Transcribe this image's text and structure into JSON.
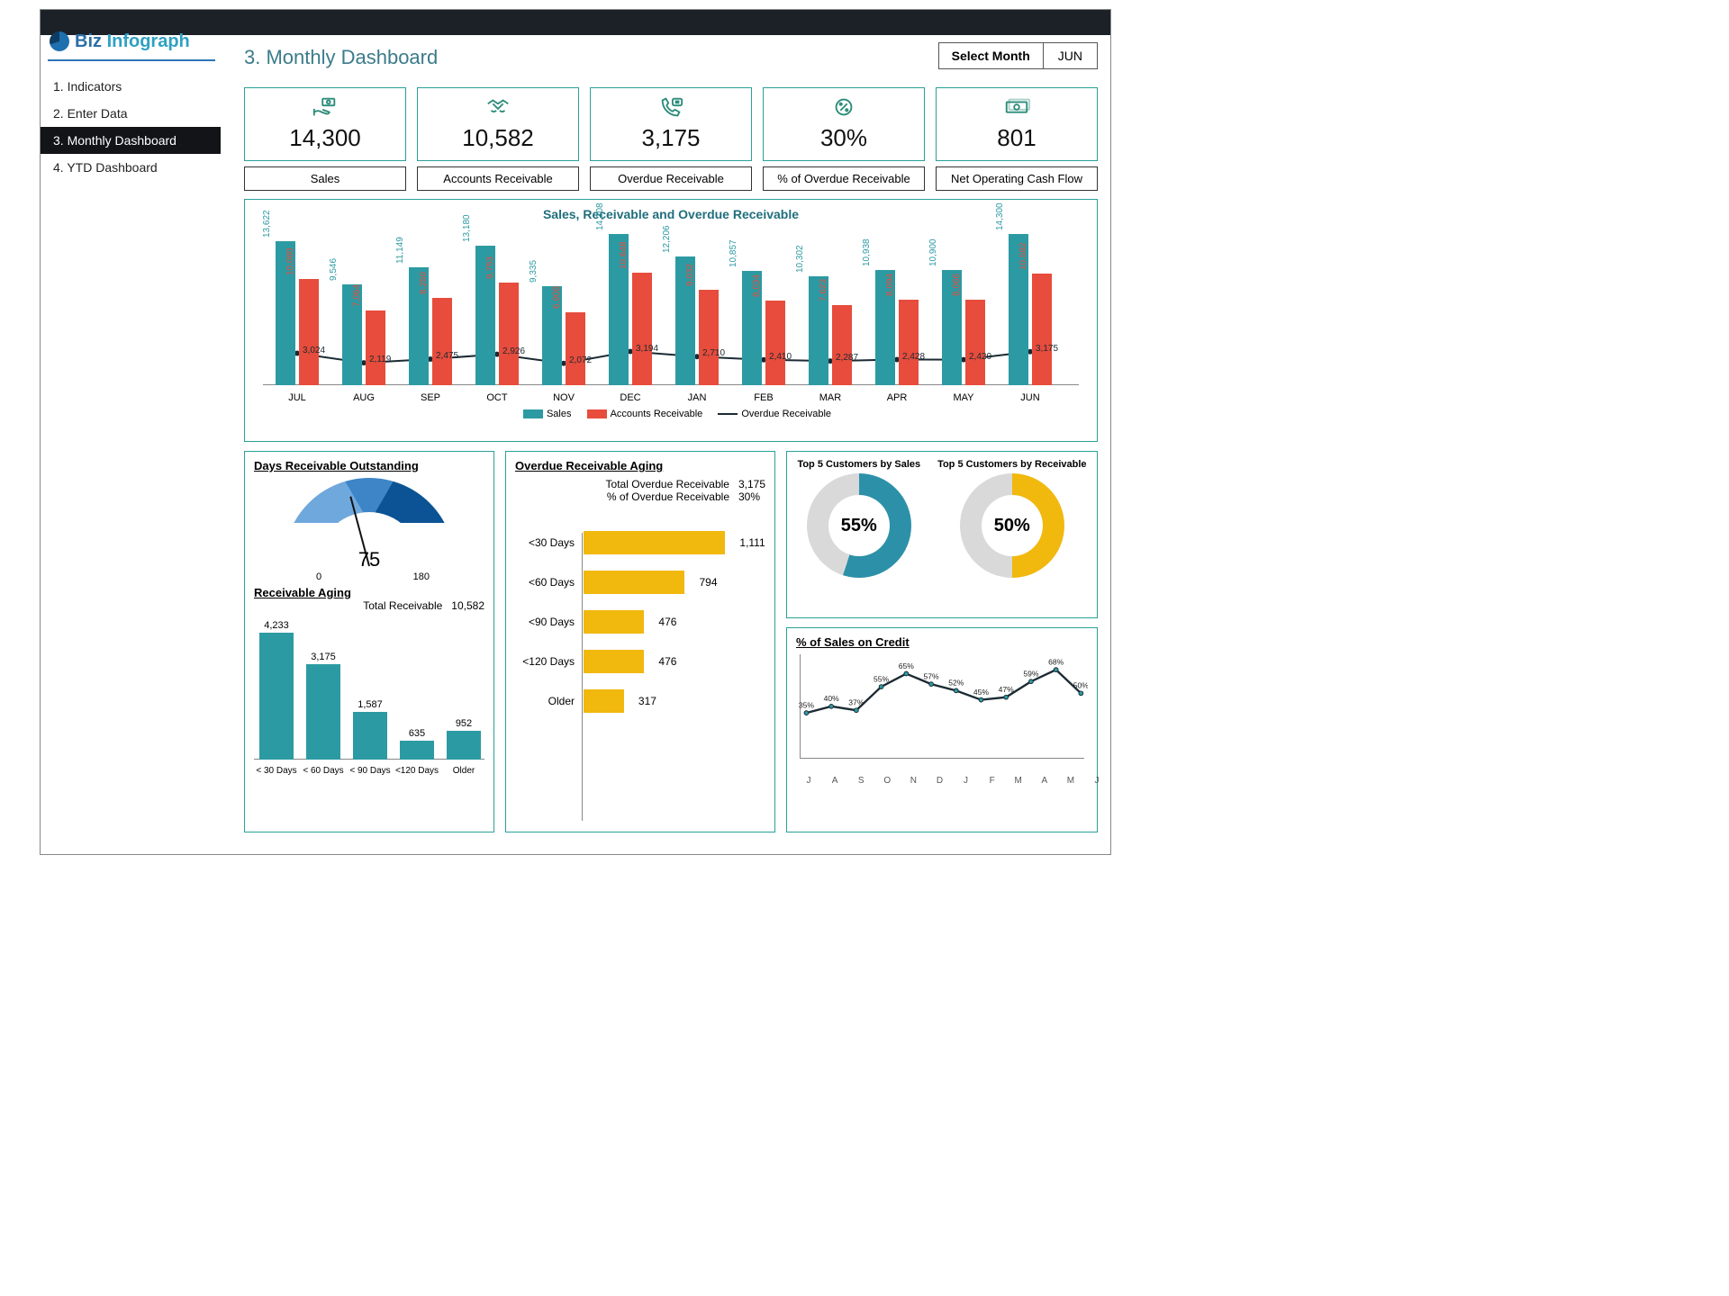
{
  "brand": {
    "part1": "Biz ",
    "part2": "Infograph"
  },
  "nav": {
    "items": [
      "1. Indicators",
      "2. Enter Data",
      "3. Monthly Dashboard",
      "4. YTD Dashboard"
    ],
    "active": 2
  },
  "page_title": "3. Monthly Dashboard",
  "month_select": {
    "label": "Select Month",
    "value": "JUN"
  },
  "kpis": [
    {
      "icon": "hand-cash-icon",
      "value": "14,300",
      "label": "Sales"
    },
    {
      "icon": "handshake-icon",
      "value": "10,582",
      "label": "Accounts Receivable"
    },
    {
      "icon": "phone-chat-icon",
      "value": "3,175",
      "label": "Overdue Receivable"
    },
    {
      "icon": "percent-badge-icon",
      "value": "30%",
      "label": "% of Overdue Receivable"
    },
    {
      "icon": "banknote-icon",
      "value": "801",
      "label": "Net Operating Cash Flow"
    }
  ],
  "main_chart": {
    "title": "Sales, Receivable and Overdue Receivable",
    "legend": {
      "sales": "Sales",
      "ar": "Accounts Receivable",
      "ov": "Overdue Receivable"
    }
  },
  "dro": {
    "title": "Days Receivable Outstanding",
    "value": "75",
    "min": "0",
    "max": "180"
  },
  "ra": {
    "title": "Receivable Aging",
    "total_label": "Total Receivable",
    "total_value": "10,582"
  },
  "oa": {
    "title": "Overdue Receivable Aging",
    "tot_label": "Total  Overdue Receivable",
    "tot_val": "3,175",
    "pct_label": "% of Overdue Receivable",
    "pct_val": "30%"
  },
  "top5": {
    "sales_title": "Top 5 Customers by Sales",
    "sales_pct": "55%",
    "recv_title": "Top 5 Customers by Receivable",
    "recv_pct": "50%"
  },
  "credit": {
    "title": "% of Sales on Credit"
  },
  "chart_data": [
    {
      "id": "sales_receivable_overdue",
      "type": "bar+line",
      "categories": [
        "JUL",
        "AUG",
        "SEP",
        "OCT",
        "NOV",
        "DEC",
        "JAN",
        "FEB",
        "MAR",
        "APR",
        "MAY",
        "JUN"
      ],
      "series": [
        {
          "name": "Sales",
          "kind": "bar",
          "values": [
            13622,
            9546,
            11149,
            13180,
            9335,
            14308,
            12206,
            10857,
            10302,
            10938,
            10900,
            14300
          ]
        },
        {
          "name": "Accounts Receivable",
          "kind": "bar",
          "values": [
            10080,
            7064,
            8250,
            9753,
            6908,
            10648,
            9032,
            8034,
            7623,
            8094,
            8066,
            10582
          ]
        },
        {
          "name": "Overdue Receivable",
          "kind": "line",
          "values": [
            3024,
            2119,
            2475,
            2926,
            2072,
            3194,
            2710,
            2410,
            2287,
            2428,
            2420,
            3175
          ]
        }
      ],
      "ylim": [
        0,
        15000
      ]
    },
    {
      "id": "days_receivable_outstanding",
      "type": "gauge",
      "value": 75,
      "min": 0,
      "max": 180
    },
    {
      "id": "receivable_aging",
      "type": "bar",
      "categories": [
        "< 30 Days",
        "< 60 Days",
        "< 90 Days",
        "<120 Days",
        "Older"
      ],
      "values": [
        4233,
        3175,
        1587,
        635,
        952
      ],
      "ylim": [
        0,
        4500
      ],
      "total": 10582
    },
    {
      "id": "overdue_receivable_aging",
      "type": "bar",
      "orientation": "horizontal",
      "categories": [
        "<30 Days",
        "<60 Days",
        "<90 Days",
        "<120 Days",
        "Older"
      ],
      "values": [
        1111,
        794,
        476,
        476,
        317
      ],
      "xlim": [
        0,
        1200
      ],
      "total": 3175,
      "pct_overdue": 30
    },
    {
      "id": "top5_customers_by_sales",
      "type": "donut",
      "value_pct": 55
    },
    {
      "id": "top5_customers_by_receivable",
      "type": "donut",
      "value_pct": 50
    },
    {
      "id": "pct_sales_on_credit",
      "type": "line",
      "categories": [
        "J",
        "A",
        "S",
        "O",
        "N",
        "D",
        "J",
        "F",
        "M",
        "A",
        "M",
        "J"
      ],
      "values": [
        35,
        40,
        37,
        55,
        65,
        57,
        52,
        45,
        47,
        59,
        68,
        50
      ],
      "ylim": [
        0,
        80
      ],
      "ylabel": "%"
    }
  ]
}
